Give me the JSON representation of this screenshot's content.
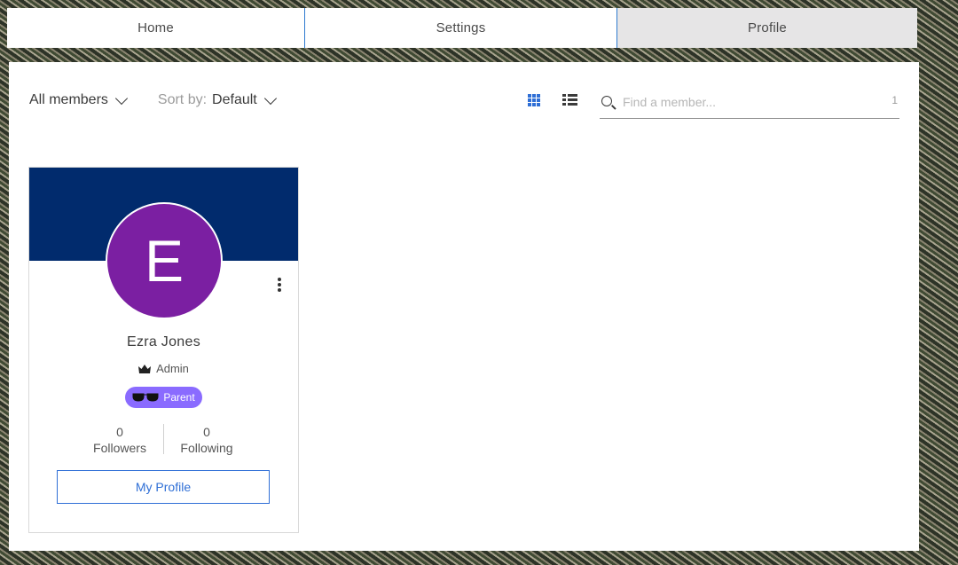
{
  "tabs": [
    {
      "label": "Home"
    },
    {
      "label": "Settings"
    },
    {
      "label": "Profile"
    }
  ],
  "filters": {
    "members_label": "All members",
    "sort_prefix": "Sort by:",
    "sort_value": "Default"
  },
  "search": {
    "placeholder": "Find a member...",
    "count": "1"
  },
  "member": {
    "initial": "E",
    "name": "Ezra Jones",
    "role": "Admin",
    "badge": "Parent",
    "followers_count": "0",
    "followers_label": "Followers",
    "following_count": "0",
    "following_label": "Following",
    "profile_button": "My Profile"
  },
  "colors": {
    "cover": "#012b6d",
    "avatar": "#7b1fa2",
    "badge": "#8a6bff",
    "accent": "#2f6fd6"
  },
  "icons": {
    "grid_view": "grid-view-icon",
    "list_view": "list-view-icon",
    "search": "search-icon",
    "crown": "crown-icon",
    "glasses": "glasses-icon",
    "more": "more-vertical-icon"
  }
}
